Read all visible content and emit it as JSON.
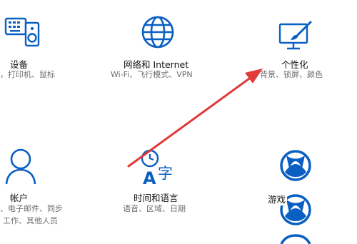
{
  "accent_color": "#0a5fc2",
  "annotation_color": "#e03a3a",
  "tiles": [
    {
      "key": "devices",
      "title": "设备",
      "subtitle": "，打印机、鼠标",
      "subtitle2": "",
      "icon": "keyboard-speaker-icon"
    },
    {
      "key": "network",
      "title": "网络和 Internet",
      "subtitle": "Wi-Fi、飞行模式、VPN",
      "subtitle2": "",
      "icon": "globe-icon"
    },
    {
      "key": "personalization",
      "title": "个性化",
      "subtitle": "背景、锁屏、颜色",
      "subtitle2": "",
      "icon": "paint-screen-icon"
    },
    {
      "key": "accounts",
      "title": "帐户",
      "subtitle": "、电子邮件、同步",
      "subtitle2": "工作、其他人员",
      "icon": "person-icon"
    },
    {
      "key": "time-language",
      "title": "时间和语言",
      "subtitle": "语音、区域、日期",
      "subtitle2": "",
      "icon": "time-language-icon"
    },
    {
      "key": "gaming",
      "title": "游戏",
      "subtitle": "",
      "subtitle2": "",
      "icon": "xbox-icon"
    }
  ]
}
